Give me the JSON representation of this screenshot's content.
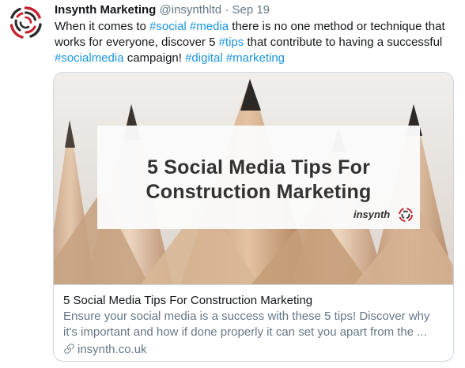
{
  "tweet": {
    "author_name": "Insynth Marketing",
    "handle": "@insynthltd",
    "separator": "·",
    "date": "Sep 19",
    "text_parts": [
      {
        "t": "When it comes to ",
        "tag": false
      },
      {
        "t": "#social",
        "tag": true
      },
      {
        "t": " ",
        "tag": false
      },
      {
        "t": "#media",
        "tag": true
      },
      {
        "t": " there is no one method or technique that works for everyone, discover 5 ",
        "tag": false
      },
      {
        "t": "#tips",
        "tag": true
      },
      {
        "t": " that contribute to having a successful ",
        "tag": false
      },
      {
        "t": "#socialmedia",
        "tag": true
      },
      {
        "t": " campaign! ",
        "tag": false
      },
      {
        "t": "#digital",
        "tag": true
      },
      {
        "t": " ",
        "tag": false
      },
      {
        "t": "#marketing",
        "tag": true
      }
    ]
  },
  "card": {
    "image_headline_line1": "5 Social Media Tips For",
    "image_headline_line2": "Construction Marketing",
    "image_logo_text": "insynth",
    "title": "5 Social Media Tips For Construction Marketing",
    "description": "Ensure your social media is a success with these 5 tips! Discover why it's important and how if done properly it can set you apart from the ...",
    "domain": "insynth.co.uk",
    "link_icon": "link-icon"
  },
  "colors": {
    "hashtag": "#1b95e0",
    "secondary_text": "#657786",
    "border": "#ccd6dd",
    "brand_red": "#c8202f"
  }
}
